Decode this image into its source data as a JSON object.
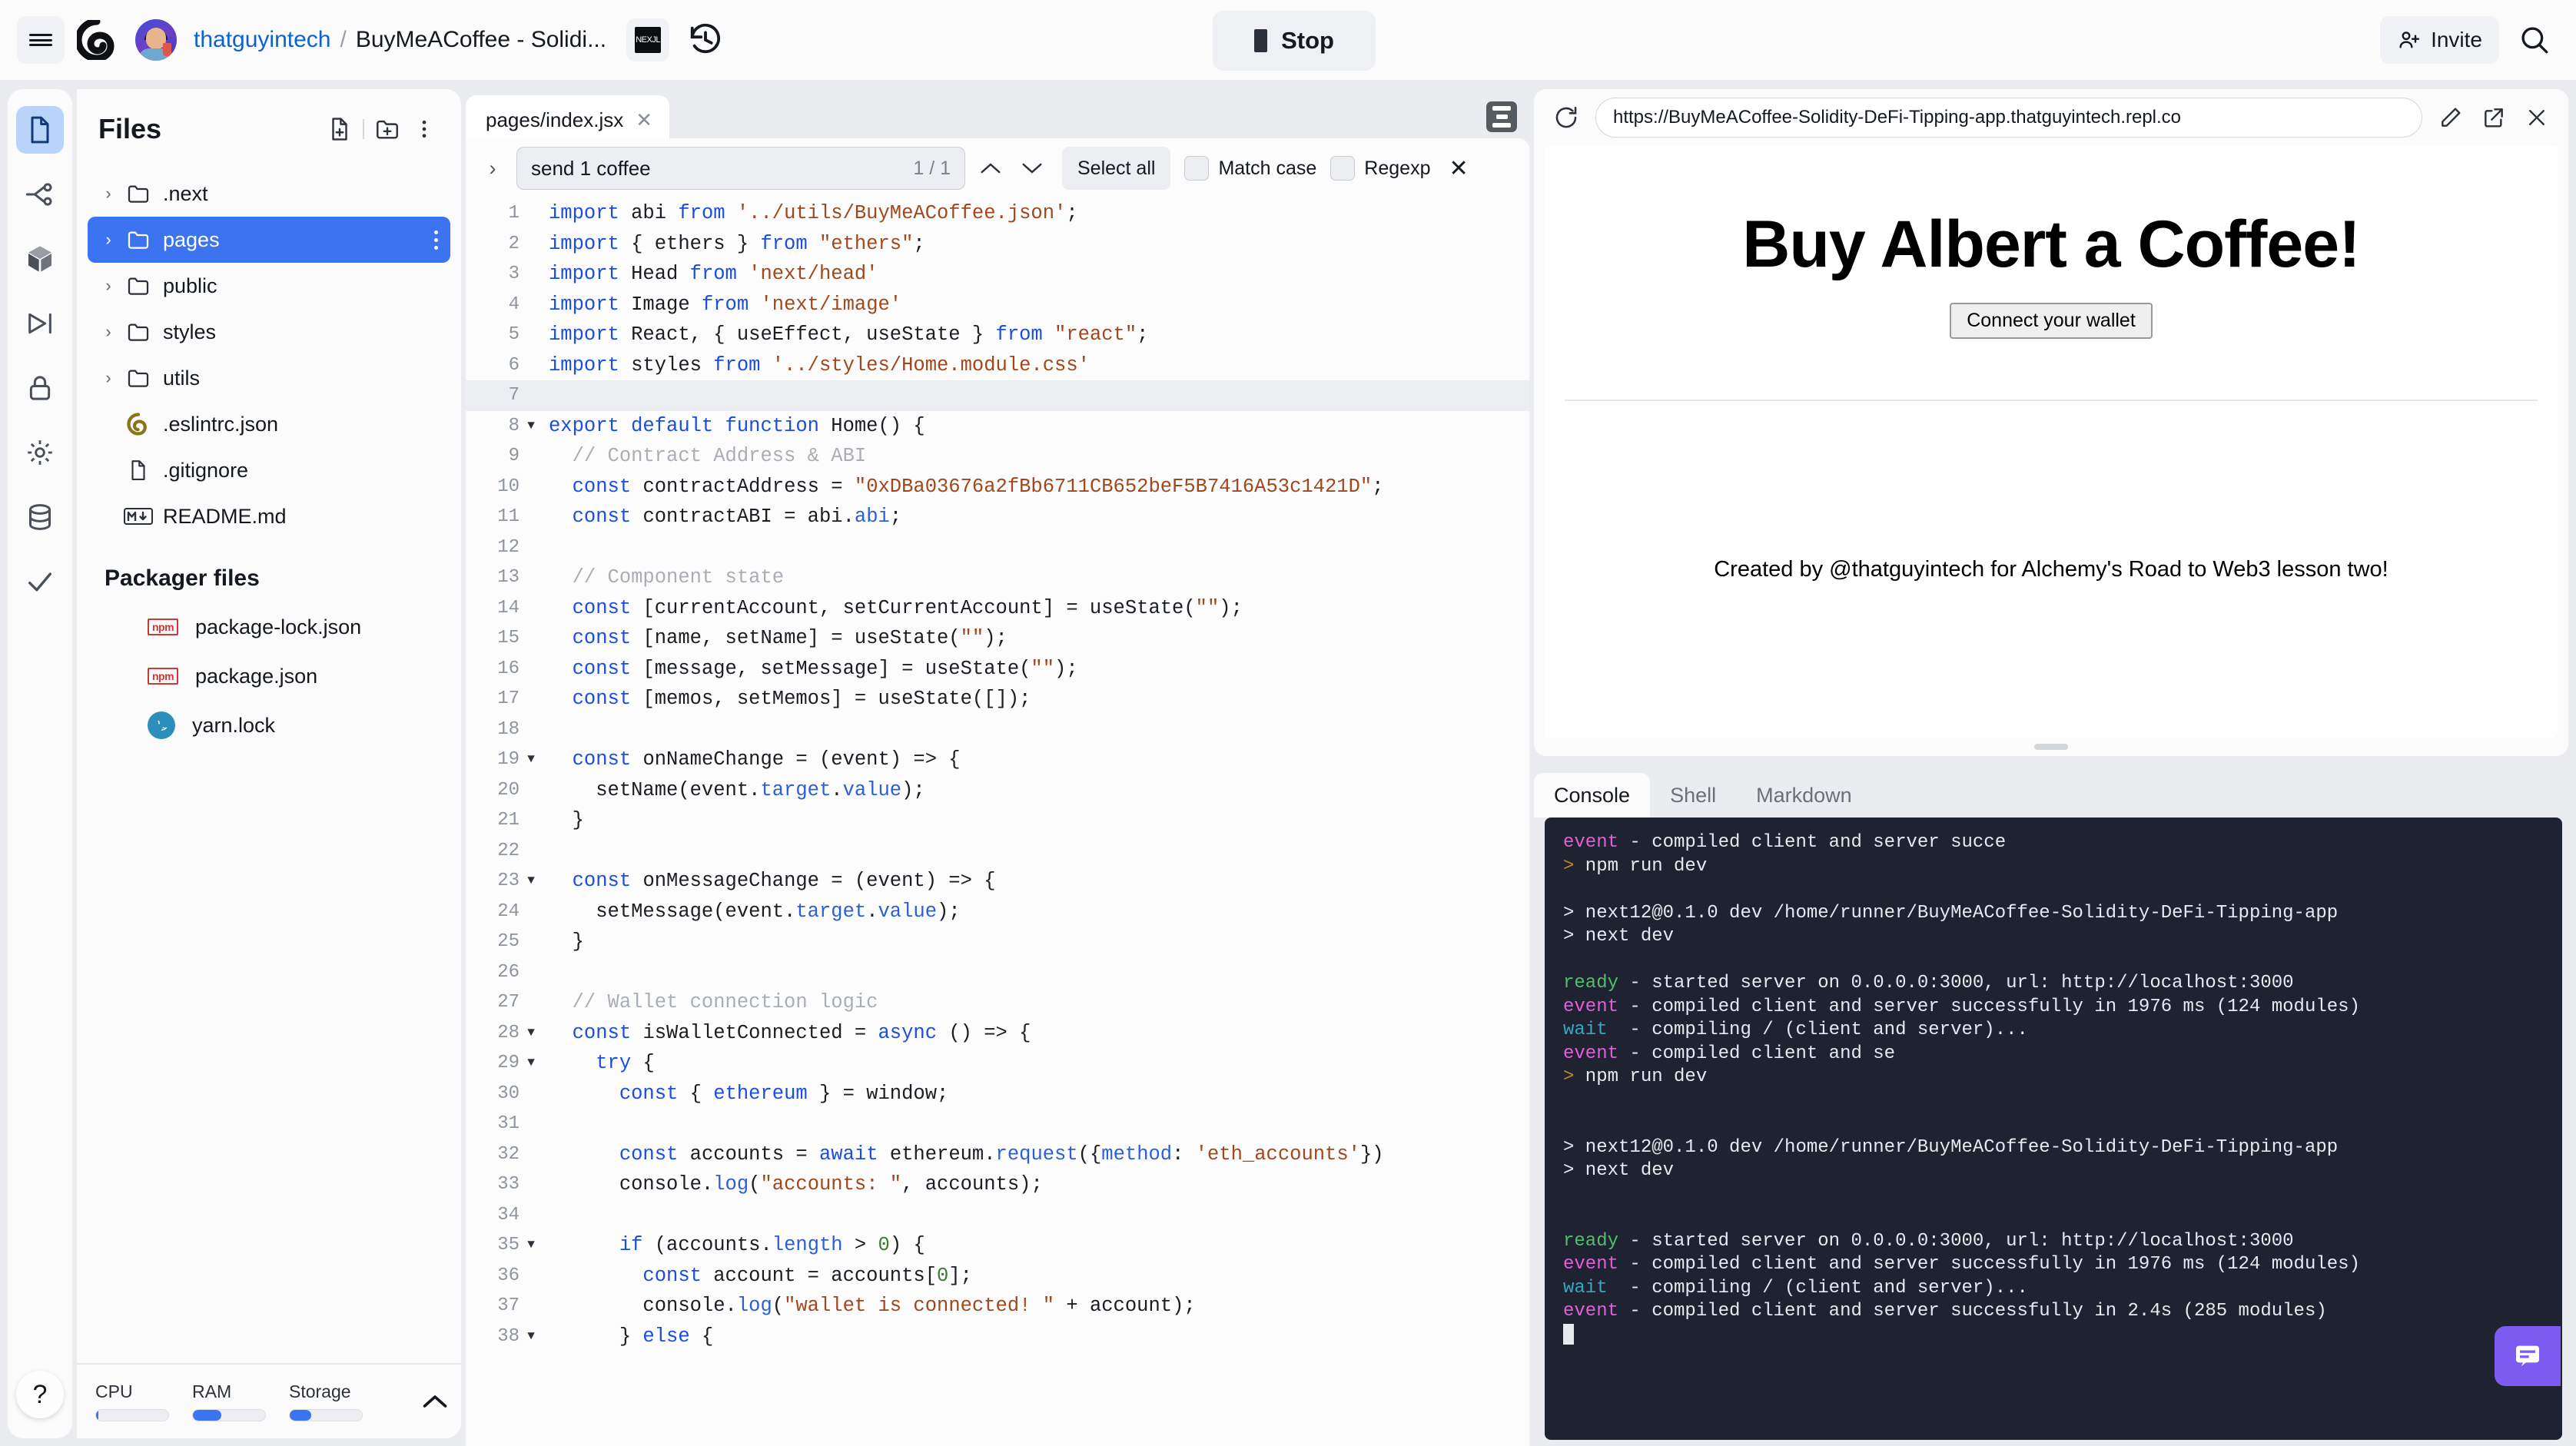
{
  "header": {
    "hamburger_icon": "hamburger-menu-icon",
    "logo_icon": "replit-logo-icon",
    "avatar_icon": "user-avatar",
    "username": "thatguyintech",
    "breadcrumb_separator": "/",
    "repl_name": "BuyMeACoffee - Solidi...",
    "framework_badge": "NEXJL",
    "history_icon": "history-clock-icon",
    "stop_label": "Stop",
    "stop_icon": "stop-square-icon",
    "invite_label": "Invite",
    "invite_icon": "person-add-icon",
    "search_icon": "search-icon"
  },
  "rail": {
    "items": [
      {
        "name": "files-icon",
        "label": "Files",
        "active": true
      },
      {
        "name": "version-control-icon",
        "label": "Version control",
        "active": false
      },
      {
        "name": "packages-icon",
        "label": "Packages",
        "active": false
      },
      {
        "name": "debugger-icon",
        "label": "Debugger",
        "active": false
      },
      {
        "name": "secrets-lock-icon",
        "label": "Secrets",
        "active": false
      },
      {
        "name": "settings-gear-icon",
        "label": "Settings",
        "active": false
      },
      {
        "name": "database-icon",
        "label": "Database",
        "active": false
      },
      {
        "name": "checkmark-icon",
        "label": "Tests",
        "active": false
      }
    ],
    "help_label": "?"
  },
  "files": {
    "title": "Files",
    "new_file_icon": "new-file-icon",
    "new_folder_icon": "new-folder-icon",
    "more_icon": "more-vertical-icon",
    "tree": [
      {
        "name": ".next",
        "type": "folder",
        "selected": false
      },
      {
        "name": "pages",
        "type": "folder",
        "selected": true
      },
      {
        "name": "public",
        "type": "folder",
        "selected": false
      },
      {
        "name": "styles",
        "type": "folder",
        "selected": false
      },
      {
        "name": "utils",
        "type": "folder",
        "selected": false
      },
      {
        "name": ".eslintrc.json",
        "type": "eslint",
        "selected": false
      },
      {
        "name": ".gitignore",
        "type": "file",
        "selected": false
      },
      {
        "name": "README.md",
        "type": "md",
        "selected": false
      }
    ],
    "packager_title": "Packager files",
    "packager": [
      {
        "name": "package-lock.json",
        "type": "npm"
      },
      {
        "name": "package.json",
        "type": "npm"
      },
      {
        "name": "yarn.lock",
        "type": "yarn"
      }
    ],
    "resources": [
      {
        "label": "CPU",
        "percent": 3
      },
      {
        "label": "RAM",
        "percent": 39
      },
      {
        "label": "Storage",
        "percent": 30
      }
    ],
    "collapse_icon": "chevron-up-icon"
  },
  "editor": {
    "tab_label": "pages/index.jsx",
    "tab_close_icon": "close-icon",
    "panel_toggle_icon": "layout-panel-icon",
    "find": {
      "expand_icon": "chevron-right-icon",
      "query": "send 1 coffee",
      "count": "1 / 1",
      "prev_icon": "chevron-up-icon",
      "next_icon": "chevron-down-icon",
      "select_all_label": "Select all",
      "match_case_label": "Match case",
      "regexp_label": "Regexp",
      "close_icon": "close-icon"
    },
    "first_line": 1,
    "code": [
      {
        "n": 1,
        "fold": "",
        "highlight": false,
        "tokens": [
          [
            "k",
            "import "
          ],
          [
            "p",
            "abi "
          ],
          [
            "k",
            "from "
          ],
          [
            "s",
            "'../utils/BuyMeACoffee.json'"
          ],
          [
            "p",
            ";"
          ]
        ]
      },
      {
        "n": 2,
        "fold": "",
        "highlight": false,
        "tokens": [
          [
            "k",
            "import "
          ],
          [
            "p",
            "{ ethers } "
          ],
          [
            "k",
            "from "
          ],
          [
            "s",
            "\"ethers\""
          ],
          [
            "p",
            ";"
          ]
        ]
      },
      {
        "n": 3,
        "fold": "",
        "highlight": false,
        "tokens": [
          [
            "k",
            "import "
          ],
          [
            "p",
            "Head "
          ],
          [
            "k",
            "from "
          ],
          [
            "s",
            "'next/head'"
          ]
        ]
      },
      {
        "n": 4,
        "fold": "",
        "highlight": false,
        "tokens": [
          [
            "k",
            "import "
          ],
          [
            "p",
            "Image "
          ],
          [
            "k",
            "from "
          ],
          [
            "s",
            "'next/image'"
          ]
        ]
      },
      {
        "n": 5,
        "fold": "",
        "highlight": false,
        "tokens": [
          [
            "k",
            "import "
          ],
          [
            "p",
            "React, { useEffect, useState } "
          ],
          [
            "k",
            "from "
          ],
          [
            "s",
            "\"react\""
          ],
          [
            "p",
            ";"
          ]
        ]
      },
      {
        "n": 6,
        "fold": "",
        "highlight": false,
        "tokens": [
          [
            "k",
            "import "
          ],
          [
            "p",
            "styles "
          ],
          [
            "k",
            "from "
          ],
          [
            "s",
            "'../styles/Home.module.css'"
          ]
        ]
      },
      {
        "n": 7,
        "fold": "",
        "highlight": true,
        "tokens": []
      },
      {
        "n": 8,
        "fold": "▼",
        "highlight": false,
        "tokens": [
          [
            "k",
            "export default function "
          ],
          [
            "p",
            "Home() {"
          ]
        ]
      },
      {
        "n": 9,
        "fold": "",
        "highlight": false,
        "tokens": [
          [
            "p",
            "  "
          ],
          [
            "c",
            "// Contract Address & ABI"
          ]
        ]
      },
      {
        "n": 10,
        "fold": "",
        "highlight": false,
        "tokens": [
          [
            "p",
            "  "
          ],
          [
            "k",
            "const "
          ],
          [
            "p",
            "contractAddress = "
          ],
          [
            "s",
            "\"0xDBa03676a2fBb6711CB652beF5B7416A53c1421D\""
          ],
          [
            "p",
            ";"
          ]
        ]
      },
      {
        "n": 11,
        "fold": "",
        "highlight": false,
        "tokens": [
          [
            "p",
            "  "
          ],
          [
            "k",
            "const "
          ],
          [
            "p",
            "contractABI = abi."
          ],
          [
            "pr",
            "abi"
          ],
          [
            "p",
            ";"
          ]
        ]
      },
      {
        "n": 12,
        "fold": "",
        "highlight": false,
        "tokens": []
      },
      {
        "n": 13,
        "fold": "",
        "highlight": false,
        "tokens": [
          [
            "p",
            "  "
          ],
          [
            "c",
            "// Component state"
          ]
        ]
      },
      {
        "n": 14,
        "fold": "",
        "highlight": false,
        "tokens": [
          [
            "p",
            "  "
          ],
          [
            "k",
            "const "
          ],
          [
            "p",
            "[currentAccount, setCurrentAccount] = useState("
          ],
          [
            "s",
            "\"\""
          ],
          [
            "p",
            ");"
          ]
        ]
      },
      {
        "n": 15,
        "fold": "",
        "highlight": false,
        "tokens": [
          [
            "p",
            "  "
          ],
          [
            "k",
            "const "
          ],
          [
            "p",
            "[name, setName] = useState("
          ],
          [
            "s",
            "\"\""
          ],
          [
            "p",
            ");"
          ]
        ]
      },
      {
        "n": 16,
        "fold": "",
        "highlight": false,
        "tokens": [
          [
            "p",
            "  "
          ],
          [
            "k",
            "const "
          ],
          [
            "p",
            "[message, setMessage] = useState("
          ],
          [
            "s",
            "\"\""
          ],
          [
            "p",
            ");"
          ]
        ]
      },
      {
        "n": 17,
        "fold": "",
        "highlight": false,
        "tokens": [
          [
            "p",
            "  "
          ],
          [
            "k",
            "const "
          ],
          [
            "p",
            "[memos, setMemos] = useState([]);"
          ]
        ]
      },
      {
        "n": 18,
        "fold": "",
        "highlight": false,
        "tokens": []
      },
      {
        "n": 19,
        "fold": "▼",
        "highlight": false,
        "tokens": [
          [
            "p",
            "  "
          ],
          [
            "k",
            "const "
          ],
          [
            "p",
            "onNameChange = (event) => {"
          ]
        ]
      },
      {
        "n": 20,
        "fold": "",
        "highlight": false,
        "tokens": [
          [
            "p",
            "    setName(event."
          ],
          [
            "pr",
            "target"
          ],
          [
            "p",
            "."
          ],
          [
            "pr",
            "value"
          ],
          [
            "p",
            ");"
          ]
        ]
      },
      {
        "n": 21,
        "fold": "",
        "highlight": false,
        "tokens": [
          [
            "p",
            "  }"
          ]
        ]
      },
      {
        "n": 22,
        "fold": "",
        "highlight": false,
        "tokens": []
      },
      {
        "n": 23,
        "fold": "▼",
        "highlight": false,
        "tokens": [
          [
            "p",
            "  "
          ],
          [
            "k",
            "const "
          ],
          [
            "p",
            "onMessageChange = (event) => {"
          ]
        ]
      },
      {
        "n": 24,
        "fold": "",
        "highlight": false,
        "tokens": [
          [
            "p",
            "    setMessage(event."
          ],
          [
            "pr",
            "target"
          ],
          [
            "p",
            "."
          ],
          [
            "pr",
            "value"
          ],
          [
            "p",
            ");"
          ]
        ]
      },
      {
        "n": 25,
        "fold": "",
        "highlight": false,
        "tokens": [
          [
            "p",
            "  }"
          ]
        ]
      },
      {
        "n": 26,
        "fold": "",
        "highlight": false,
        "tokens": []
      },
      {
        "n": 27,
        "fold": "",
        "highlight": false,
        "tokens": [
          [
            "p",
            "  "
          ],
          [
            "c",
            "// Wallet connection logic"
          ]
        ]
      },
      {
        "n": 28,
        "fold": "▼",
        "highlight": false,
        "tokens": [
          [
            "p",
            "  "
          ],
          [
            "k",
            "const "
          ],
          [
            "p",
            "isWalletConnected = "
          ],
          [
            "k",
            "async "
          ],
          [
            "p",
            "() => {"
          ]
        ]
      },
      {
        "n": 29,
        "fold": "▼",
        "highlight": false,
        "tokens": [
          [
            "p",
            "    "
          ],
          [
            "k",
            "try "
          ],
          [
            "p",
            "{"
          ]
        ]
      },
      {
        "n": 30,
        "fold": "",
        "highlight": false,
        "tokens": [
          [
            "p",
            "      "
          ],
          [
            "k",
            "const "
          ],
          [
            "p",
            "{ "
          ],
          [
            "k",
            "ethereum"
          ],
          [
            "p",
            " } = window;"
          ]
        ]
      },
      {
        "n": 31,
        "fold": "",
        "highlight": false,
        "tokens": []
      },
      {
        "n": 32,
        "fold": "",
        "highlight": false,
        "tokens": [
          [
            "p",
            "      "
          ],
          [
            "k",
            "const "
          ],
          [
            "p",
            "accounts = "
          ],
          [
            "k",
            "await "
          ],
          [
            "p",
            "ethereum."
          ],
          [
            "pr",
            "request"
          ],
          [
            "p",
            "({"
          ],
          [
            "pr",
            "method"
          ],
          [
            "p",
            ": "
          ],
          [
            "s",
            "'eth_accounts'"
          ],
          [
            "p",
            "})"
          ]
        ]
      },
      {
        "n": 33,
        "fold": "",
        "highlight": false,
        "tokens": [
          [
            "p",
            "      console."
          ],
          [
            "pr",
            "log"
          ],
          [
            "p",
            "("
          ],
          [
            "s",
            "\"accounts: \""
          ],
          [
            "p",
            ", accounts);"
          ]
        ]
      },
      {
        "n": 34,
        "fold": "",
        "highlight": false,
        "tokens": []
      },
      {
        "n": 35,
        "fold": "▼",
        "highlight": false,
        "tokens": [
          [
            "p",
            "      "
          ],
          [
            "k",
            "if "
          ],
          [
            "p",
            "(accounts."
          ],
          [
            "pr",
            "length"
          ],
          [
            "p",
            " > "
          ],
          [
            "n",
            "0"
          ],
          [
            "p",
            ") {"
          ]
        ]
      },
      {
        "n": 36,
        "fold": "",
        "highlight": false,
        "tokens": [
          [
            "p",
            "        "
          ],
          [
            "k",
            "const "
          ],
          [
            "p",
            "account = accounts["
          ],
          [
            "n",
            "0"
          ],
          [
            "p",
            "];"
          ]
        ]
      },
      {
        "n": 37,
        "fold": "",
        "highlight": false,
        "tokens": [
          [
            "p",
            "        console."
          ],
          [
            "pr",
            "log"
          ],
          [
            "p",
            "("
          ],
          [
            "s",
            "\"wallet is connected! \""
          ],
          [
            "p",
            " + account);"
          ]
        ]
      },
      {
        "n": 38,
        "fold": "▼",
        "highlight": false,
        "tokens": [
          [
            "p",
            "      } "
          ],
          [
            "k",
            "else "
          ],
          [
            "p",
            "{"
          ]
        ]
      }
    ]
  },
  "webview": {
    "reload_icon": "reload-icon",
    "url": "https://BuyMeACoffee-Solidity-DeFi-Tipping-app.thatguyintech.repl.co",
    "pencil_icon": "pencil-edit-icon",
    "open_external_icon": "open-external-icon",
    "close_icon": "close-icon",
    "page_title": "Buy Albert a Coffee!",
    "connect_button": "Connect your wallet",
    "footer_text": "Created by @thatguyintech for Alchemy's Road to Web3 lesson two!"
  },
  "console": {
    "tabs": [
      {
        "label": "Console",
        "active": true
      },
      {
        "label": "Shell",
        "active": false
      },
      {
        "label": "Markdown",
        "active": false
      }
    ],
    "lines": [
      {
        "type": "event",
        "tag": "event",
        "text": " - compiled client and server succe"
      },
      {
        "type": "prompt",
        "tag": ">",
        "text": " npm run dev"
      },
      {
        "type": "blank",
        "tag": "",
        "text": ""
      },
      {
        "type": "plain",
        "tag": "",
        "text": "> next12@0.1.0 dev /home/runner/BuyMeACoffee-Solidity-DeFi-Tipping-app"
      },
      {
        "type": "plain",
        "tag": "",
        "text": "> next dev"
      },
      {
        "type": "blank",
        "tag": "",
        "text": ""
      },
      {
        "type": "ready",
        "tag": "ready",
        "text": " - started server on 0.0.0.0:3000, url: http://localhost:3000"
      },
      {
        "type": "event",
        "tag": "event",
        "text": " - compiled client and server successfully in 1976 ms (124 modules)"
      },
      {
        "type": "wait",
        "tag": "wait",
        "text": "  - compiling / (client and server)..."
      },
      {
        "type": "event",
        "tag": "event",
        "text": " - compiled client and se"
      },
      {
        "type": "prompt",
        "tag": ">",
        "text": " npm run dev"
      },
      {
        "type": "blank",
        "tag": "",
        "text": ""
      },
      {
        "type": "blank",
        "tag": "",
        "text": ""
      },
      {
        "type": "plain",
        "tag": "",
        "text": "> next12@0.1.0 dev /home/runner/BuyMeACoffee-Solidity-DeFi-Tipping-app"
      },
      {
        "type": "plain",
        "tag": "",
        "text": "> next dev"
      },
      {
        "type": "blank",
        "tag": "",
        "text": ""
      },
      {
        "type": "blank",
        "tag": "",
        "text": ""
      },
      {
        "type": "ready",
        "tag": "ready",
        "text": " - started server on 0.0.0.0:3000, url: http://localhost:3000"
      },
      {
        "type": "event",
        "tag": "event",
        "text": " - compiled client and server successfully in 1976 ms (124 modules)"
      },
      {
        "type": "wait",
        "tag": "wait",
        "text": "  - compiling / (client and server)..."
      },
      {
        "type": "event",
        "tag": "event",
        "text": " - compiled client and server successfully in 2.4s (285 modules)"
      },
      {
        "type": "caret",
        "tag": "",
        "text": ""
      }
    ],
    "help_bubble_icon": "chat-help-icon"
  },
  "colors": {
    "accent_blue": "#3c73f0",
    "link_blue": "#0b63ce",
    "terminal_bg": "#1f2231",
    "event_magenta": "#e25fd6",
    "ready_green": "#4fbf6e",
    "wait_cyan": "#38a6c0",
    "npm_red": "#cb3837",
    "help_purple": "#7c5cf0"
  }
}
